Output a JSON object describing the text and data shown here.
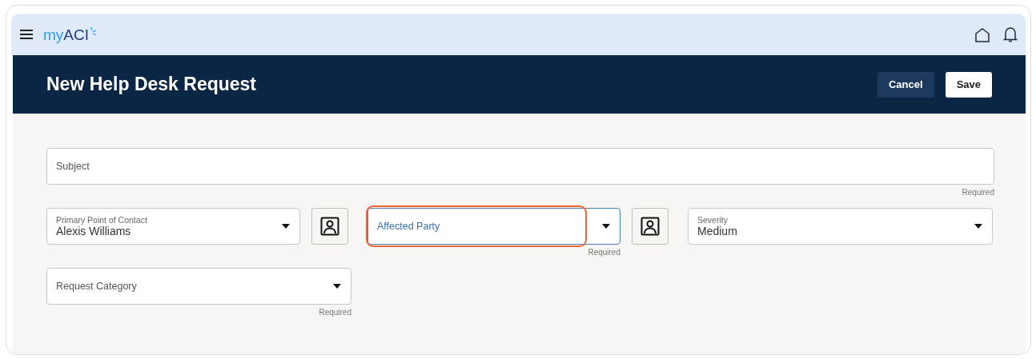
{
  "header": {
    "logo": [
      "my",
      "ACI"
    ]
  },
  "page": {
    "title": "New Help Desk Request",
    "buttons": [
      {
        "label": "Cancel",
        "kind": "secondary"
      },
      {
        "label": "Save",
        "kind": "primary"
      }
    ]
  },
  "form": {
    "rows": [
      [
        {
          "kind": "text",
          "label": "Subject",
          "hint": "Required"
        }
      ],
      [
        {
          "kind": "select",
          "label": "Primary Point of Contact",
          "value": "Alexis Williams",
          "contact_picker": true
        },
        {
          "kind": "select",
          "label": "Affected Party",
          "hint": "Required",
          "focused": true,
          "highlighted": true,
          "contact_picker": true
        },
        {
          "kind": "select",
          "label": "Severity",
          "value": "Medium"
        }
      ],
      [
        {
          "kind": "select",
          "label": "Request Category",
          "hint": "Required"
        }
      ]
    ]
  }
}
